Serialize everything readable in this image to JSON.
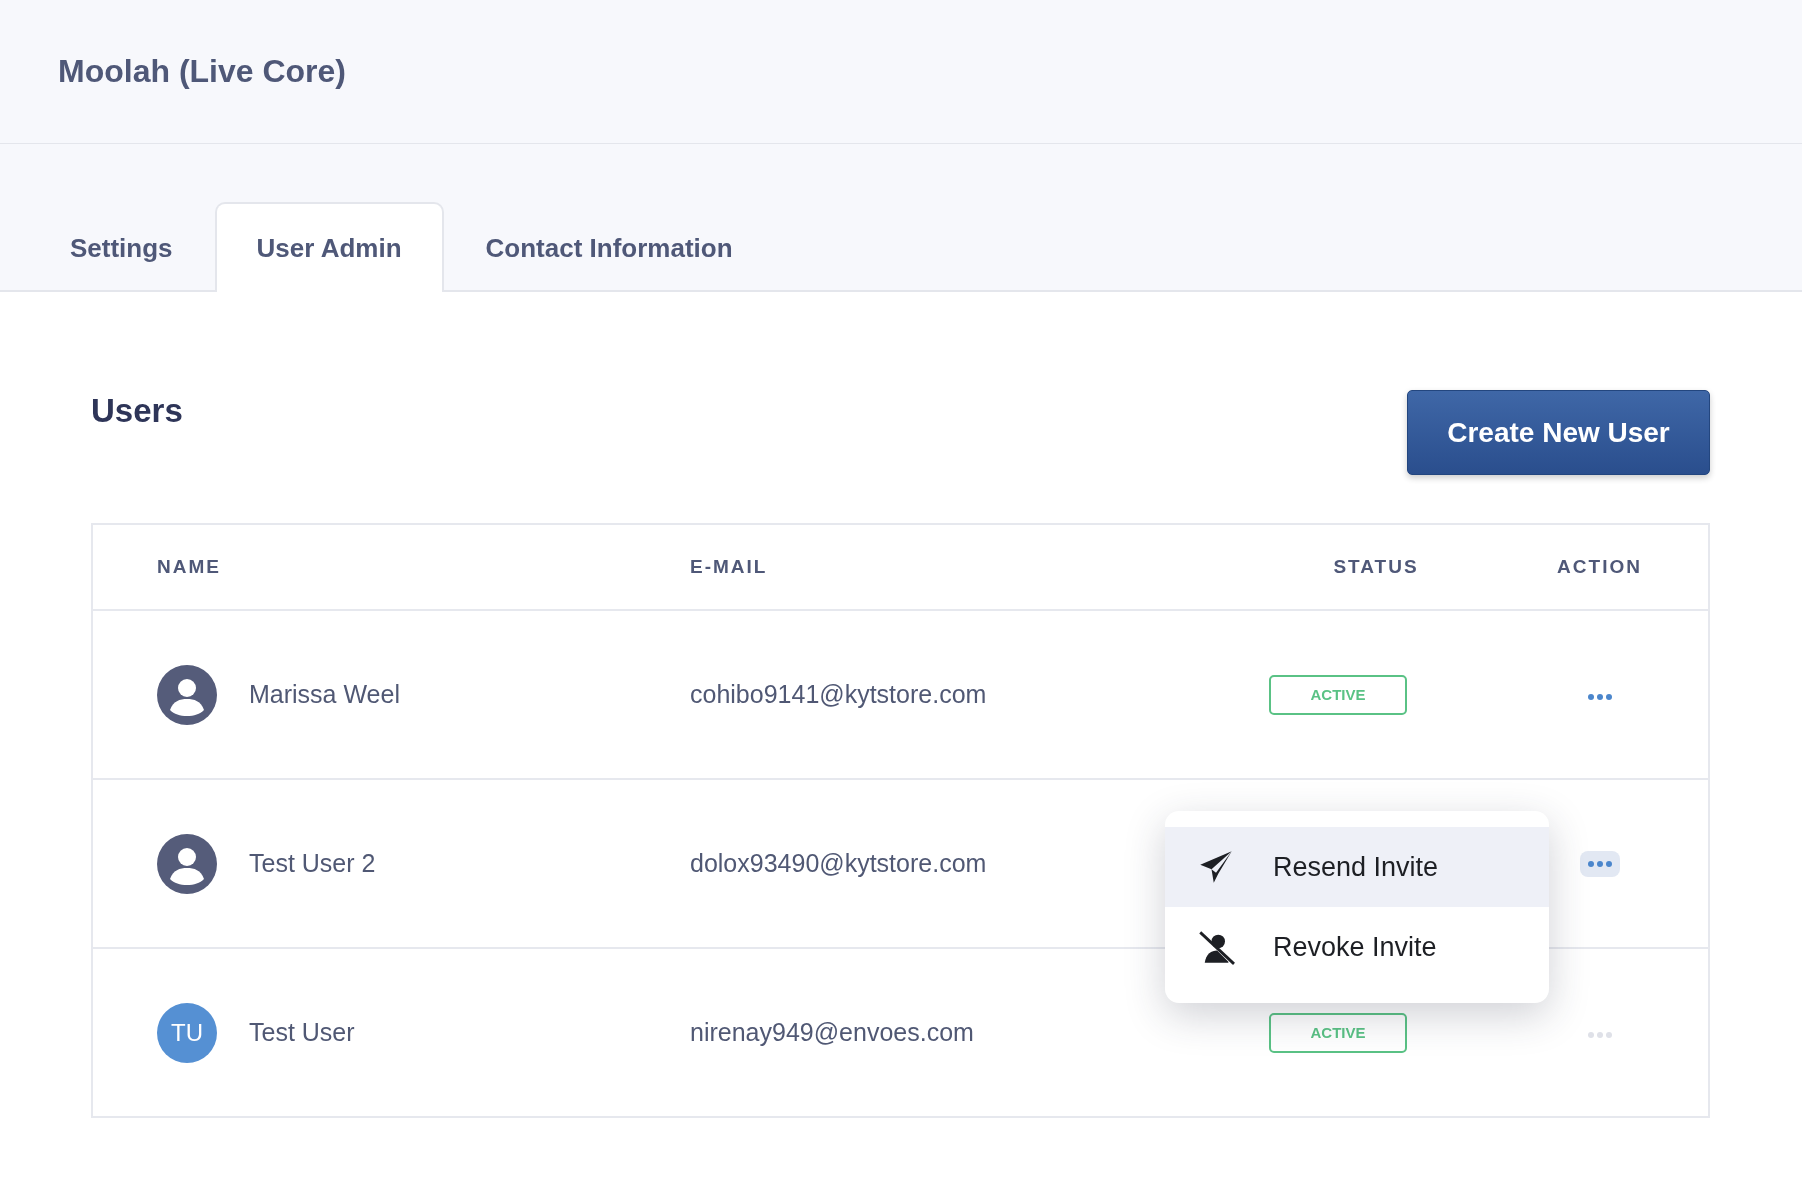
{
  "header": {
    "title": "Moolah (Live Core)"
  },
  "tabs": [
    {
      "label": "Settings",
      "selected": false
    },
    {
      "label": "User Admin",
      "selected": true
    },
    {
      "label": "Contact Information",
      "selected": false
    }
  ],
  "section": {
    "title": "Users",
    "button": "Create New User"
  },
  "table": {
    "columns": [
      "NAME",
      "E-MAIL",
      "STATUS",
      "ACTION"
    ],
    "rows": [
      {
        "avatar": {
          "kind": "silhouette"
        },
        "name": "Marissa Weel",
        "email": "cohibo9141@kytstore.com",
        "status": "ACTIVE",
        "action_disabled": false,
        "menu_open": false
      },
      {
        "avatar": {
          "kind": "silhouette"
        },
        "name": "Test User 2",
        "email": "dolox93490@kytstore.com",
        "action_disabled": false,
        "menu_open": true
      },
      {
        "avatar": {
          "kind": "initials",
          "initials": "TU"
        },
        "name": "Test User",
        "email": "nirenay949@envoes.com",
        "status": "ACTIVE",
        "action_disabled": true,
        "menu_open": false
      }
    ]
  },
  "action_menu": {
    "items": [
      {
        "kind": "resend",
        "label": "Resend Invite",
        "selected": true
      },
      {
        "kind": "revoke",
        "label": "Revoke Invite",
        "selected": false
      }
    ]
  }
}
